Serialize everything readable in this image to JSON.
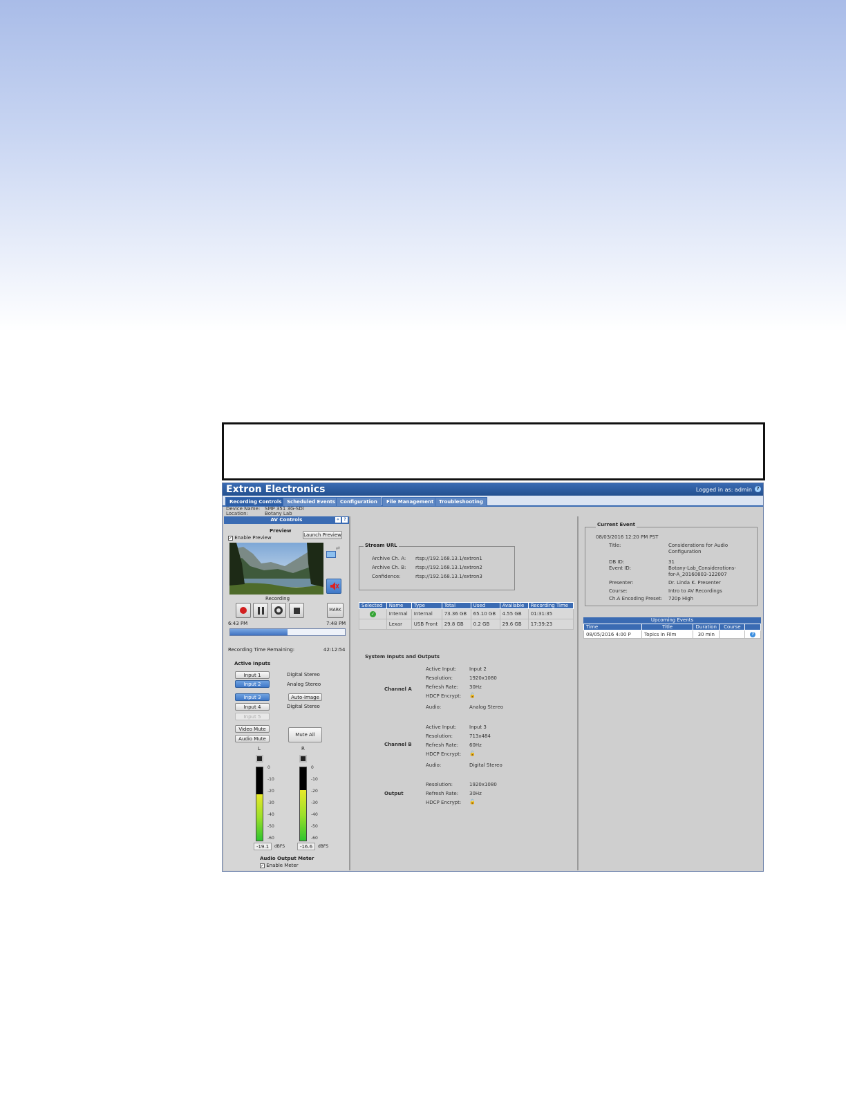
{
  "header": {
    "brand": "Extron Electronics",
    "login": "Logged in as: admin"
  },
  "tabs": [
    "Recording Controls",
    "Scheduled Events",
    "Configuration",
    "File Management",
    "Troubleshooting"
  ],
  "device": {
    "name_label": "Device Name:",
    "name_value": "SMP 351 3G-SDI",
    "location_label": "Location:",
    "location_value": "Botany Lab"
  },
  "av_controls": {
    "title": "AV Controls",
    "preview_label": "Preview",
    "enable_preview": "Enable Preview",
    "launch_preview": "Launch Preview",
    "recording_label": "Recording",
    "mark": "MARK",
    "start_time": "6:43 PM",
    "end_time": "7:48 PM",
    "progress_fraction": 0.5,
    "time_remaining_label": "Recording Time Remaining:",
    "time_remaining_value": "42:12:54",
    "active_inputs_label": "Active Inputs",
    "inputs": [
      {
        "label": "Input 1",
        "audio": "Digital Stereo"
      },
      {
        "label": "Input 2",
        "audio": "Analog Stereo"
      },
      {
        "label": "Input 3",
        "audio": ""
      },
      {
        "label": "Input 4",
        "audio": "Digital Stereo"
      },
      {
        "label": "Input 5",
        "audio": ""
      }
    ],
    "auto_image": "Auto-Image",
    "video_mute": "Video Mute",
    "audio_mute": "Audio Mute",
    "mute_all": "Mute All",
    "meter_left_label": "L",
    "meter_right_label": "R",
    "scale": [
      "0",
      "-10",
      "-20",
      "-30",
      "-40",
      "-50",
      "-60"
    ],
    "left_db": "-19.1",
    "right_db": "-16.6",
    "dbfs": "dBFS",
    "left_level": 0.63,
    "right_level": 0.69,
    "output_meter_label": "Audio Output Meter",
    "enable_meter": "Enable Meter"
  },
  "stream_url": {
    "title": "Stream URL",
    "rows": [
      {
        "label": "Archive Ch. A:",
        "value": "rtsp://192.168.13.1/extron1"
      },
      {
        "label": "Archive Ch. B:",
        "value": "rtsp://192.168.13.1/extron2"
      },
      {
        "label": "Confidence:",
        "value": "rtsp://192.168.13.1/extron3"
      }
    ]
  },
  "storage": {
    "headers": [
      "Selected",
      "Name",
      "Type",
      "Total",
      "Used",
      "Available",
      "Recording Time"
    ],
    "rows": [
      [
        "",
        "Internal",
        "Internal",
        "73.36 GB",
        "65.10 GB",
        "4.55 GB",
        "01:31:35"
      ],
      [
        "",
        "Lexar",
        "USB Front",
        "29.8 GB",
        "0.2 GB",
        "29.6 GB",
        "17:39:23"
      ]
    ]
  },
  "system_io": {
    "title": "System Inputs and Outputs",
    "channel_a": {
      "label": "Channel A",
      "rows": [
        [
          "Active Input:",
          "Input 2"
        ],
        [
          "Resolution:",
          "1920x1080"
        ],
        [
          "Refresh Rate:",
          "30Hz"
        ],
        [
          "HDCP Encrypt:",
          ""
        ],
        [
          "Audio:",
          "Analog Stereo"
        ]
      ]
    },
    "channel_b": {
      "label": "Channel B",
      "rows": [
        [
          "Active Input:",
          "Input 3"
        ],
        [
          "Resolution:",
          "713x484"
        ],
        [
          "Refresh Rate:",
          "60Hz"
        ],
        [
          "HDCP Encrypt:",
          ""
        ],
        [
          "Audio:",
          "Digital Stereo"
        ]
      ]
    },
    "output": {
      "label": "Output",
      "rows": [
        [
          "Resolution:",
          "1920x1080"
        ],
        [
          "Refresh Rate:",
          "30Hz"
        ],
        [
          "HDCP Encrypt:",
          ""
        ]
      ]
    }
  },
  "current_event": {
    "title": "Current Event",
    "datetime": "08/03/2016 12:20 PM PST",
    "rows": [
      [
        "Title:",
        "Considerations for Audio Configuration"
      ],
      [
        "DB ID:",
        "31"
      ],
      [
        "Event ID:",
        "Botany-Lab_Considerations-for-A_20160803-122007"
      ],
      [
        "Presenter:",
        "Dr. Linda K. Presenter"
      ],
      [
        "Course:",
        "Intro to AV Recordings"
      ],
      [
        "Ch.A Encoding Preset:",
        "720p High"
      ]
    ]
  },
  "upcoming": {
    "title": "Upcoming Events",
    "headers": [
      "Time",
      "Title",
      "Duration",
      "Course"
    ],
    "rows": [
      [
        "08/05/2016 4:00 P",
        "Topics in Film",
        "30 min",
        ""
      ]
    ]
  }
}
